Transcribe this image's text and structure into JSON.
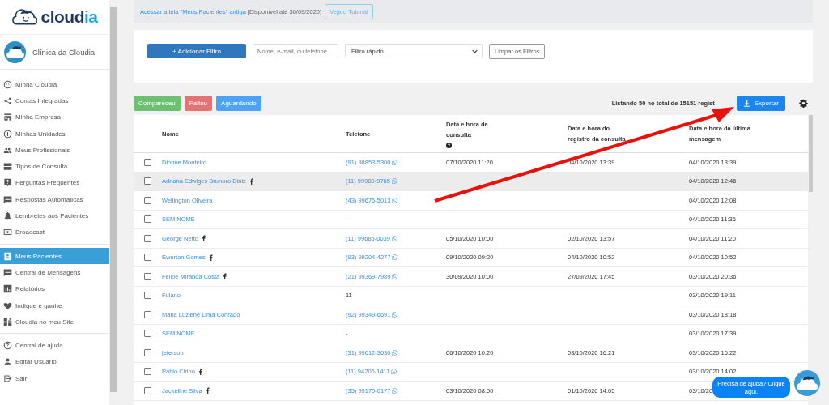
{
  "logo": {
    "main": "cloud",
    "accent": "ia"
  },
  "clinic": {
    "name": "Clínica da Cloudia"
  },
  "sidebar": {
    "groups": [
      [
        {
          "label": "Minha Cloudia",
          "selected": false
        },
        {
          "label": "Contas Integradas",
          "selected": false
        },
        {
          "label": "Minha Empresa",
          "selected": false
        },
        {
          "label": "Minhas Unidades",
          "selected": false
        },
        {
          "label": "Meus Profissionais",
          "selected": false
        },
        {
          "label": "Tipos de Consulta",
          "selected": false
        },
        {
          "label": "Perguntas Frequentes",
          "selected": false
        },
        {
          "label": "Respostas Automáticas",
          "selected": false
        },
        {
          "label": "Lembretes aos Pacientes",
          "selected": false
        },
        {
          "label": "Broadcast",
          "selected": false
        }
      ],
      [
        {
          "label": "Meus Pacientes",
          "selected": true
        },
        {
          "label": "Central de Mensagens",
          "selected": false
        },
        {
          "label": "Relatórios",
          "selected": false
        },
        {
          "label": "Indique e ganhe",
          "selected": false
        },
        {
          "label": "Cloudia no meu Site",
          "selected": false
        }
      ],
      [
        {
          "label": "Central de ajuda",
          "selected": false
        },
        {
          "label": "Editar Usuário",
          "selected": false
        },
        {
          "label": "Sair",
          "selected": false
        }
      ]
    ]
  },
  "banner": {
    "link": "Acessar a tela \"Meus Pacientes\" antiga",
    "note": "[Disponível até 30/09/2020]",
    "button": "Veja o Tutorial"
  },
  "filters": {
    "add_button": "+ Adicionar Filtro",
    "search": {
      "placeholder": "Nome, e-mail, ou telefone"
    },
    "quick_filter": "Filtro rápido",
    "clear_button": "Limpar os Filtros"
  },
  "status_buttons": [
    {
      "label": "Compareceu",
      "color": "#6cc070"
    },
    {
      "label": "Faltou",
      "color": "#e57373"
    },
    {
      "label": "Aguardando",
      "color": "#4da3f7"
    }
  ],
  "listing": "Listando 50 no total de 15151 regist",
  "export_button": "Exportar",
  "table": {
    "columns": [
      {
        "label": "Nome",
        "help": false
      },
      {
        "label": "Telefone",
        "help": false
      },
      {
        "label": "Data e hora da consulta",
        "help": true
      },
      {
        "label": "Data e hora do registro da consulta",
        "help": false
      },
      {
        "label": "Data e hora da última mensagem",
        "help": false
      }
    ],
    "rows": [
      {
        "name": "Dionne Monteiro",
        "facebook": false,
        "phone": "(91) 98853-5300",
        "whatsapp": true,
        "consulta": "07/10/2020 11:20",
        "registro": "04/10/2020 13:39",
        "ultima": "04/10/2020 13:39",
        "checked": false,
        "highlighted": false
      },
      {
        "name": "Adriana Edwiges Brunoro Diniz",
        "facebook": true,
        "phone": "(11) 99980-9765",
        "whatsapp": true,
        "consulta": "",
        "registro": "",
        "ultima": "04/10/2020 12:46",
        "checked": false,
        "highlighted": true
      },
      {
        "name": "Wellington Oliveira",
        "facebook": false,
        "phone": "(43) 99676-5013",
        "whatsapp": true,
        "consulta": "",
        "registro": "",
        "ultima": "04/10/2020 12:08",
        "checked": false,
        "highlighted": false
      },
      {
        "name": "SEM NOME",
        "facebook": false,
        "phone": "-",
        "whatsapp": false,
        "consulta": "",
        "registro": "",
        "ultima": "04/10/2020 11:36",
        "checked": false,
        "highlighted": false
      },
      {
        "name": "George Netto",
        "facebook": true,
        "phone": "(11) 99685-0039",
        "whatsapp": true,
        "consulta": "05/10/2020 10:00",
        "registro": "02/10/2020 13:57",
        "ultima": "04/10/2020 11:20",
        "checked": false,
        "highlighted": false
      },
      {
        "name": "Ewerton Gomes",
        "facebook": true,
        "phone": "(93) 99204-4277",
        "whatsapp": true,
        "consulta": "09/10/2020 09:20",
        "registro": "04/10/2020 10:52",
        "ultima": "04/10/2020 10:52",
        "checked": false,
        "highlighted": false
      },
      {
        "name": "Felipe Miranda Costa",
        "facebook": true,
        "phone": "(21) 99369-7989",
        "whatsapp": true,
        "consulta": "30/09/2020 10:00",
        "registro": "27/09/2020 17:45",
        "ultima": "03/10/2020 20:36",
        "checked": false,
        "highlighted": false
      },
      {
        "name": "Fulano",
        "facebook": false,
        "phone": "11",
        "whatsapp": false,
        "consulta": "",
        "registro": "",
        "ultima": "03/10/2020 19:11",
        "checked": false,
        "highlighted": false
      },
      {
        "name": "Maria Luziene Lima Conrado",
        "facebook": false,
        "phone": "(92) 99349-6691",
        "whatsapp": true,
        "consulta": "",
        "registro": "",
        "ultima": "03/10/2020 18:18",
        "checked": false,
        "highlighted": false
      },
      {
        "name": "SEM NOME",
        "facebook": false,
        "phone": "-",
        "whatsapp": false,
        "consulta": "",
        "registro": "",
        "ultima": "03/10/2020 17:39",
        "checked": false,
        "highlighted": false
      },
      {
        "name": "jeferson",
        "facebook": false,
        "phone": "(31) 99612-3630",
        "whatsapp": true,
        "consulta": "06/10/2020 10:20",
        "registro": "03/10/2020 16:21",
        "ultima": "03/10/2020 16:22",
        "checked": false,
        "highlighted": false
      },
      {
        "name": "Pablo Cirino",
        "facebook": true,
        "phone": "(11) 94206-1411",
        "whatsapp": true,
        "consulta": "",
        "registro": "",
        "ultima": "03/10/2020 14:02",
        "checked": false,
        "highlighted": false
      },
      {
        "name": "Jackeline Silva",
        "facebook": true,
        "phone": "(35) 99170-0177",
        "whatsapp": true,
        "consulta": "03/10/2020 08:00",
        "registro": "01/10/2020 14:05",
        "ultima": "03/10/20",
        "checked": false,
        "highlighted": false
      }
    ]
  },
  "help_chat": {
    "text": "Precisa de ajuda? Clique aqui."
  }
}
